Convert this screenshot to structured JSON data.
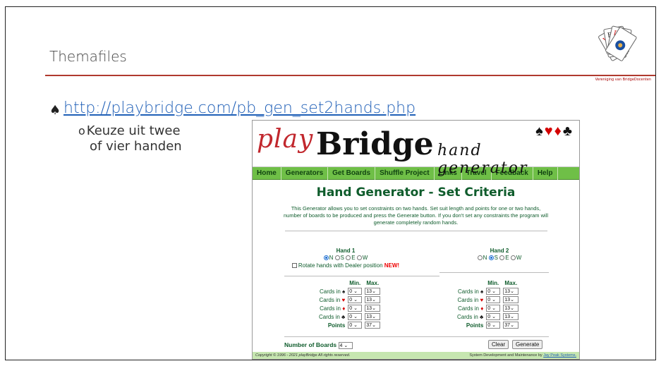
{
  "slide": {
    "title": "Themafiles",
    "bullet_symbol": "♠",
    "link_text": "http://playbridge.com/pb_gen_set2hands.php",
    "sub_bullet_marker": "o",
    "sub_bullet_line1": "Keuze uit twee",
    "sub_bullet_line2": "of vier handen",
    "logo_caption": "Vereniging van BridgeDocenten",
    "accent_color": "#b03a2e"
  },
  "playbridge": {
    "logo_play": "play",
    "logo_bridge": "Bridge",
    "logo_subtitle": "hand generator",
    "suits": [
      "♠",
      "♥",
      "♦",
      "♣"
    ],
    "nav": [
      "Home",
      "Generators",
      "Get Boards",
      "Shuffle Project",
      "Links",
      "Travel",
      "Feedback",
      "Help"
    ],
    "heading": "Hand Generator - Set Criteria",
    "intro": "This Generator allows you to set constraints on two hands. Set suit length and points for one or two hands, number of boards to be produced and press the Generate button. If you don't set any constraints the program will generate completely random hands.",
    "hand1": {
      "title": "Hand 1",
      "options": [
        "N",
        "S",
        "E",
        "W"
      ],
      "selected": "N",
      "rotate_label": "Rotate hands with Dealer position",
      "new_label": "NEW!"
    },
    "hand2": {
      "title": "Hand 2",
      "options": [
        "N",
        "S",
        "E",
        "W"
      ],
      "selected": "S"
    },
    "criteria": {
      "min_label": "Min.",
      "max_label": "Max.",
      "rows": [
        {
          "label": "Cards in",
          "suit": "♠",
          "min": "0",
          "max": "13"
        },
        {
          "label": "Cards in",
          "suit": "♥",
          "min": "0",
          "max": "13"
        },
        {
          "label": "Cards in",
          "suit": "♦",
          "min": "0",
          "max": "13"
        },
        {
          "label": "Cards in",
          "suit": "♣",
          "min": "0",
          "max": "13"
        },
        {
          "label": "Points",
          "suit": "",
          "min": "0",
          "max": "37"
        }
      ]
    },
    "boards_label": "Number of Boards",
    "boards_value": "4",
    "clear_label": "Clear",
    "generate_label": "Generate",
    "footer_left": "Copyright © 1996 - 2021 playBridge All rights reserved.",
    "footer_right_prefix": "System Development and Maintenance by ",
    "footer_right_link": "Jay Peak Systems.",
    "nav_color": "#6fbf47",
    "text_green": "#0f5c2c"
  }
}
